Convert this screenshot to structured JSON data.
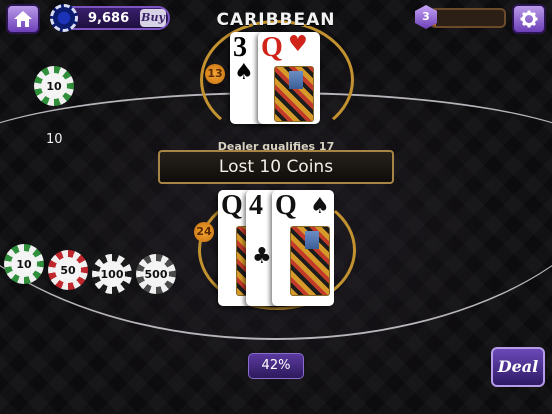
{
  "header": {
    "coins": "9,686",
    "buy_label": "Buy",
    "title": "CARIBBEAN",
    "level": "3",
    "level_progress": 0.05
  },
  "current_bet": {
    "chip_value": "10",
    "amount": "10"
  },
  "dealer": {
    "score": "13",
    "cards": [
      {
        "rank": "3",
        "suit": "♠",
        "color": "black"
      },
      {
        "rank": "Q",
        "suit": "♥",
        "color": "red"
      }
    ],
    "label_behind_banner": "Dealer qualifies 17"
  },
  "result_banner": "Lost 10 Coins",
  "player": {
    "score": "24",
    "cards": [
      {
        "rank": "Q",
        "suit": "♣",
        "color": "black"
      },
      {
        "rank": "4",
        "suit": "♣",
        "color": "black"
      },
      {
        "rank": "Q",
        "suit": "♠",
        "color": "black"
      }
    ]
  },
  "chips": [
    {
      "value": "10",
      "color": "#2f8f3a"
    },
    {
      "value": "50",
      "color": "#c0272d"
    },
    {
      "value": "100",
      "color": "#1b1b1b"
    },
    {
      "value": "500",
      "color": "#4a4a4a"
    }
  ],
  "footer": {
    "percent": "42%",
    "deal_label": "Deal"
  },
  "colors": {
    "accent_purple": "#6c3fb8",
    "table_gold": "#c39230",
    "background": "#0c0b0d"
  },
  "icons": {
    "home": "home-icon",
    "settings": "gear-icon",
    "coin": "coin-icon"
  }
}
